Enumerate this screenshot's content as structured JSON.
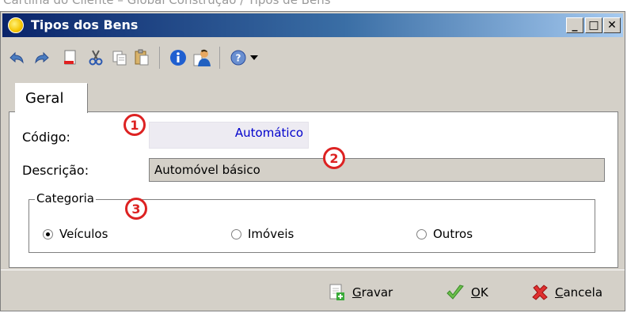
{
  "caption": "Cartilha do Cliente – Global Construção / Tipos de Bens",
  "window": {
    "title": "Tipos dos Bens",
    "controls": {
      "minimize": "_",
      "maximize": "□",
      "close": "✕"
    }
  },
  "toolbar": {
    "icons": [
      "undo-icon",
      "redo-icon",
      "delete-document-icon",
      "cut-icon",
      "copy-icon",
      "paste-icon",
      "info-icon",
      "user-document-icon",
      "help-icon",
      "dropdown-arrow-icon"
    ]
  },
  "tabs": [
    {
      "label": "Geral",
      "selected": true
    }
  ],
  "form": {
    "codigo_label": "Código:",
    "codigo_value": "Automático",
    "descricao_label": "Descrição:",
    "descricao_value": "Automóvel básico",
    "categoria_label": "Categoria",
    "categoria_options": [
      {
        "label": "Veículos",
        "selected": true
      },
      {
        "label": "Imóveis",
        "selected": false
      },
      {
        "label": "Outros",
        "selected": false
      }
    ]
  },
  "markers": [
    "1",
    "2",
    "3"
  ],
  "buttons": {
    "gravar": {
      "accel": "G",
      "rest": "ravar"
    },
    "ok": {
      "accel": "O",
      "rest": "K"
    },
    "cancela": {
      "accel": "C",
      "rest": "ancela"
    }
  },
  "colors": {
    "title_bar": "#0a246a",
    "marker": "#dd2222",
    "code_text": "#0000cc",
    "window_face": "#d4d0c8"
  }
}
